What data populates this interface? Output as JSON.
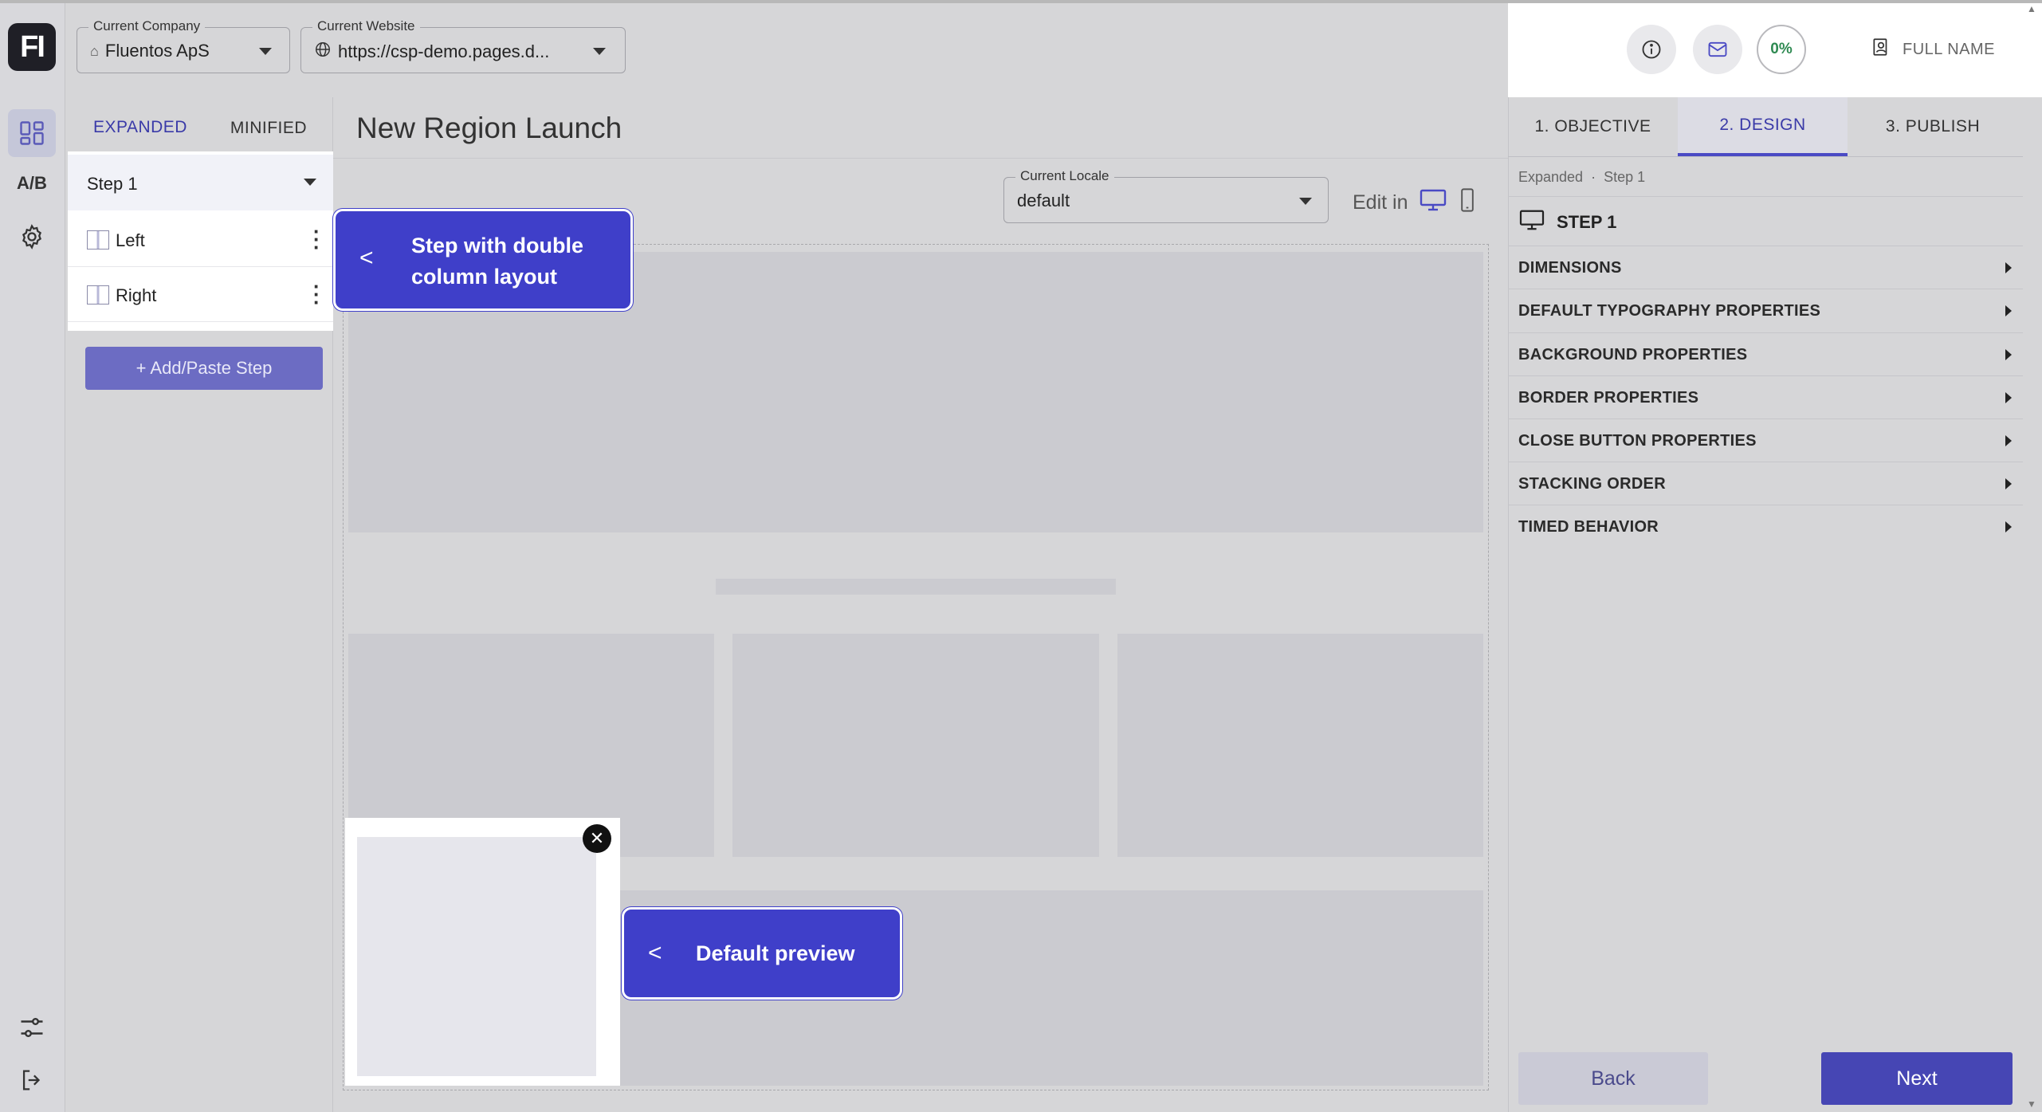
{
  "brand": {
    "logo_text": "FI",
    "accent": "#4646b4",
    "callout_color": "#3f3fc9"
  },
  "rail": {
    "ab_label": "A/B"
  },
  "header": {
    "company": {
      "label": "Current Company",
      "value": "Fluentos ApS"
    },
    "website": {
      "label": "Current Website",
      "value": "https://csp-demo.pages.d..."
    },
    "progress": "0%",
    "user": "FULL NAME"
  },
  "left_panel": {
    "tabs": [
      "EXPANDED",
      "MINIFIED"
    ],
    "step": "Step 1",
    "items": [
      "Left",
      "Right"
    ],
    "add_step": "+ Add/Paste Step"
  },
  "canvas": {
    "title": "New Region Launch",
    "locale": {
      "label": "Current Locale",
      "value": "default"
    },
    "edit_in": "Edit in"
  },
  "callouts": {
    "step": {
      "arrow": "<",
      "text_line1": "Step with double",
      "text_line2": "column layout"
    },
    "preview": {
      "arrow": "<",
      "text": "Default preview"
    }
  },
  "right_panel": {
    "tabs": [
      "1. OBJECTIVE",
      "2. DESIGN",
      "3. PUBLISH"
    ],
    "breadcrumb": "Expanded  ·  Step 1",
    "step_title": "STEP 1",
    "sections": [
      "DIMENSIONS",
      "DEFAULT TYPOGRAPHY PROPERTIES",
      "BACKGROUND PROPERTIES",
      "BORDER PROPERTIES",
      "CLOSE BUTTON PROPERTIES",
      "STACKING ORDER",
      "TIMED BEHAVIOR"
    ],
    "back": "Back",
    "next": "Next"
  }
}
